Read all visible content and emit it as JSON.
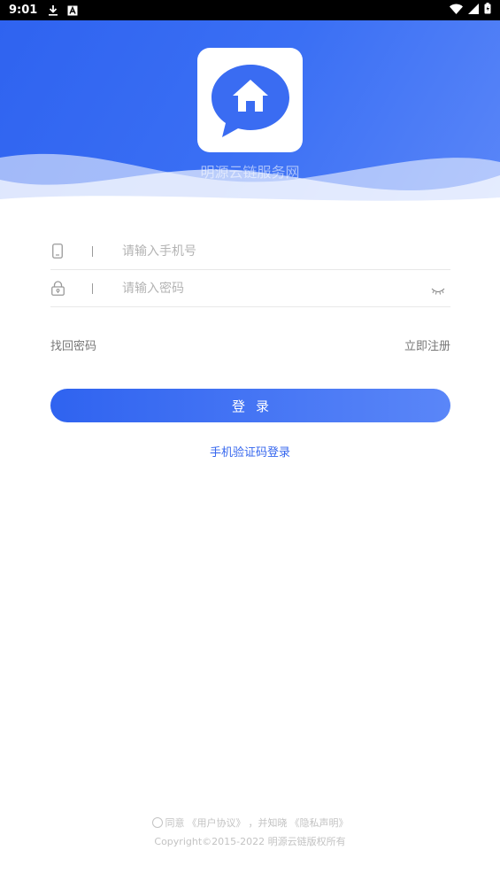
{
  "status_bar": {
    "time": "9:01",
    "icons": [
      "download-icon",
      "a-badge-icon",
      "wifi-icon",
      "signal-icon",
      "battery-icon"
    ]
  },
  "header": {
    "app_name": "明源云链服务网",
    "colors": {
      "gradient_start": "#2f63f0",
      "gradient_end": "#5a86f8"
    }
  },
  "form": {
    "phone": {
      "placeholder": "请输入手机号",
      "icon": "phone-icon"
    },
    "password": {
      "placeholder": "请输入密码",
      "icon": "lock-icon",
      "toggle_icon": "eye-closed-icon"
    }
  },
  "links": {
    "forgot": "找回密码",
    "register": "立即注册"
  },
  "login_button": "登录",
  "sms_login": "手机验证码登录",
  "footer": {
    "agree_prefix": "同意",
    "user_agreement": "《用户协议》",
    "and_know": "，并知晓",
    "privacy": "《隐私声明》",
    "copyright": "Copyright©2015-2022 明源云链版权所有"
  }
}
